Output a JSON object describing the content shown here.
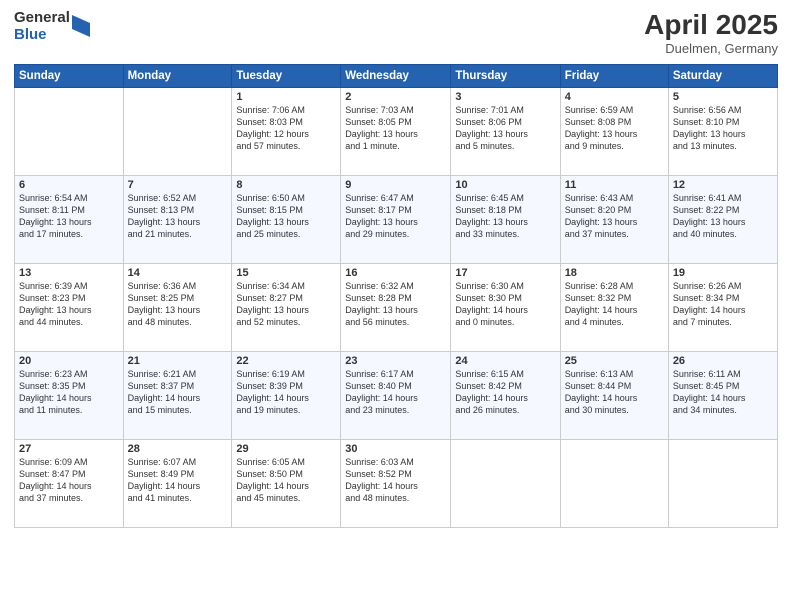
{
  "logo": {
    "general": "General",
    "blue": "Blue"
  },
  "title": "April 2025",
  "location": "Duelmen, Germany",
  "days_header": [
    "Sunday",
    "Monday",
    "Tuesday",
    "Wednesday",
    "Thursday",
    "Friday",
    "Saturday"
  ],
  "weeks": [
    [
      {
        "day": "",
        "detail": ""
      },
      {
        "day": "",
        "detail": ""
      },
      {
        "day": "1",
        "detail": "Sunrise: 7:06 AM\nSunset: 8:03 PM\nDaylight: 12 hours\nand 57 minutes."
      },
      {
        "day": "2",
        "detail": "Sunrise: 7:03 AM\nSunset: 8:05 PM\nDaylight: 13 hours\nand 1 minute."
      },
      {
        "day": "3",
        "detail": "Sunrise: 7:01 AM\nSunset: 8:06 PM\nDaylight: 13 hours\nand 5 minutes."
      },
      {
        "day": "4",
        "detail": "Sunrise: 6:59 AM\nSunset: 8:08 PM\nDaylight: 13 hours\nand 9 minutes."
      },
      {
        "day": "5",
        "detail": "Sunrise: 6:56 AM\nSunset: 8:10 PM\nDaylight: 13 hours\nand 13 minutes."
      }
    ],
    [
      {
        "day": "6",
        "detail": "Sunrise: 6:54 AM\nSunset: 8:11 PM\nDaylight: 13 hours\nand 17 minutes."
      },
      {
        "day": "7",
        "detail": "Sunrise: 6:52 AM\nSunset: 8:13 PM\nDaylight: 13 hours\nand 21 minutes."
      },
      {
        "day": "8",
        "detail": "Sunrise: 6:50 AM\nSunset: 8:15 PM\nDaylight: 13 hours\nand 25 minutes."
      },
      {
        "day": "9",
        "detail": "Sunrise: 6:47 AM\nSunset: 8:17 PM\nDaylight: 13 hours\nand 29 minutes."
      },
      {
        "day": "10",
        "detail": "Sunrise: 6:45 AM\nSunset: 8:18 PM\nDaylight: 13 hours\nand 33 minutes."
      },
      {
        "day": "11",
        "detail": "Sunrise: 6:43 AM\nSunset: 8:20 PM\nDaylight: 13 hours\nand 37 minutes."
      },
      {
        "day": "12",
        "detail": "Sunrise: 6:41 AM\nSunset: 8:22 PM\nDaylight: 13 hours\nand 40 minutes."
      }
    ],
    [
      {
        "day": "13",
        "detail": "Sunrise: 6:39 AM\nSunset: 8:23 PM\nDaylight: 13 hours\nand 44 minutes."
      },
      {
        "day": "14",
        "detail": "Sunrise: 6:36 AM\nSunset: 8:25 PM\nDaylight: 13 hours\nand 48 minutes."
      },
      {
        "day": "15",
        "detail": "Sunrise: 6:34 AM\nSunset: 8:27 PM\nDaylight: 13 hours\nand 52 minutes."
      },
      {
        "day": "16",
        "detail": "Sunrise: 6:32 AM\nSunset: 8:28 PM\nDaylight: 13 hours\nand 56 minutes."
      },
      {
        "day": "17",
        "detail": "Sunrise: 6:30 AM\nSunset: 8:30 PM\nDaylight: 14 hours\nand 0 minutes."
      },
      {
        "day": "18",
        "detail": "Sunrise: 6:28 AM\nSunset: 8:32 PM\nDaylight: 14 hours\nand 4 minutes."
      },
      {
        "day": "19",
        "detail": "Sunrise: 6:26 AM\nSunset: 8:34 PM\nDaylight: 14 hours\nand 7 minutes."
      }
    ],
    [
      {
        "day": "20",
        "detail": "Sunrise: 6:23 AM\nSunset: 8:35 PM\nDaylight: 14 hours\nand 11 minutes."
      },
      {
        "day": "21",
        "detail": "Sunrise: 6:21 AM\nSunset: 8:37 PM\nDaylight: 14 hours\nand 15 minutes."
      },
      {
        "day": "22",
        "detail": "Sunrise: 6:19 AM\nSunset: 8:39 PM\nDaylight: 14 hours\nand 19 minutes."
      },
      {
        "day": "23",
        "detail": "Sunrise: 6:17 AM\nSunset: 8:40 PM\nDaylight: 14 hours\nand 23 minutes."
      },
      {
        "day": "24",
        "detail": "Sunrise: 6:15 AM\nSunset: 8:42 PM\nDaylight: 14 hours\nand 26 minutes."
      },
      {
        "day": "25",
        "detail": "Sunrise: 6:13 AM\nSunset: 8:44 PM\nDaylight: 14 hours\nand 30 minutes."
      },
      {
        "day": "26",
        "detail": "Sunrise: 6:11 AM\nSunset: 8:45 PM\nDaylight: 14 hours\nand 34 minutes."
      }
    ],
    [
      {
        "day": "27",
        "detail": "Sunrise: 6:09 AM\nSunset: 8:47 PM\nDaylight: 14 hours\nand 37 minutes."
      },
      {
        "day": "28",
        "detail": "Sunrise: 6:07 AM\nSunset: 8:49 PM\nDaylight: 14 hours\nand 41 minutes."
      },
      {
        "day": "29",
        "detail": "Sunrise: 6:05 AM\nSunset: 8:50 PM\nDaylight: 14 hours\nand 45 minutes."
      },
      {
        "day": "30",
        "detail": "Sunrise: 6:03 AM\nSunset: 8:52 PM\nDaylight: 14 hours\nand 48 minutes."
      },
      {
        "day": "",
        "detail": ""
      },
      {
        "day": "",
        "detail": ""
      },
      {
        "day": "",
        "detail": ""
      }
    ]
  ]
}
